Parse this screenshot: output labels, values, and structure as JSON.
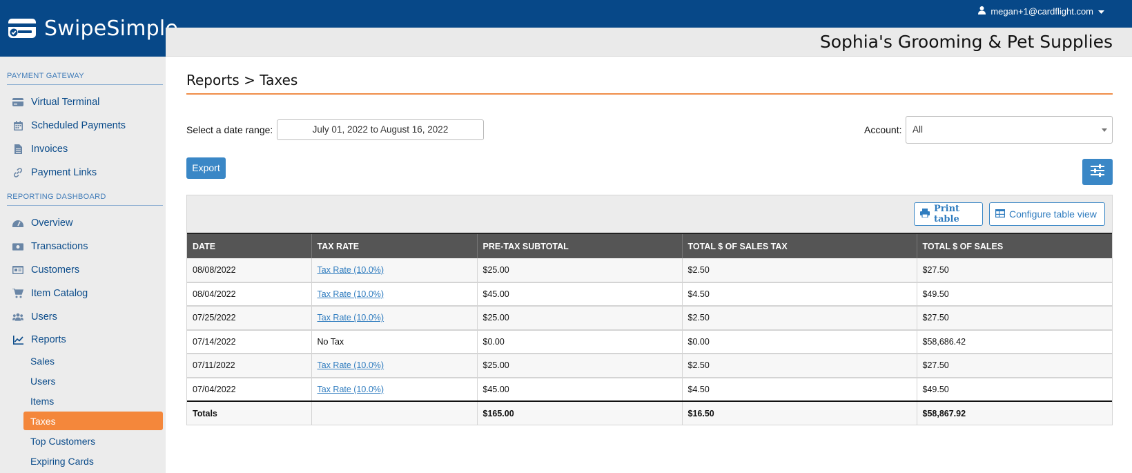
{
  "app": {
    "name": "SwipeSimple"
  },
  "user": {
    "email": "megan+1@cardflight.com"
  },
  "merchant": {
    "name": "Sophia's Grooming & Pet Supplies"
  },
  "sidebar": {
    "sections": [
      {
        "title": "PAYMENT GATEWAY"
      },
      {
        "title": "REPORTING DASHBOARD"
      }
    ],
    "gateway_items": [
      {
        "label": "Virtual Terminal",
        "icon": "credit-card-icon"
      },
      {
        "label": "Scheduled Payments",
        "icon": "calendar-icon"
      },
      {
        "label": "Invoices",
        "icon": "document-icon"
      },
      {
        "label": "Payment Links",
        "icon": "link-icon"
      }
    ],
    "dashboard_items": [
      {
        "label": "Overview",
        "icon": "gauge-icon"
      },
      {
        "label": "Transactions",
        "icon": "money-icon"
      },
      {
        "label": "Customers",
        "icon": "id-card-icon"
      },
      {
        "label": "Item Catalog",
        "icon": "cart-icon"
      },
      {
        "label": "Users",
        "icon": "users-icon"
      },
      {
        "label": "Reports",
        "icon": "chart-icon"
      }
    ],
    "report_subitems": [
      {
        "label": "Sales"
      },
      {
        "label": "Users"
      },
      {
        "label": "Items"
      },
      {
        "label": "Taxes",
        "active": true
      },
      {
        "label": "Top Customers"
      },
      {
        "label": "Expiring Cards"
      }
    ]
  },
  "page": {
    "breadcrumb": "Reports > Taxes",
    "date_range_label": "Select a date range:",
    "date_range_value": "July 01, 2022 to August 16, 2022",
    "account_label": "Account:",
    "account_value": "All",
    "export_label": "Export",
    "print_label": "Print table",
    "configure_label": "Configure table view"
  },
  "table": {
    "headers": [
      "DATE",
      "TAX RATE",
      "PRE-TAX SUBTOTAL",
      "TOTAL $ OF SALES TAX",
      "TOTAL $ OF SALES"
    ],
    "rows": [
      {
        "date": "08/08/2022",
        "rate": "Tax Rate (10.0%)",
        "rate_link": true,
        "subtotal": "$25.00",
        "tax": "$2.50",
        "total": "$27.50"
      },
      {
        "date": "08/04/2022",
        "rate": "Tax Rate (10.0%)",
        "rate_link": true,
        "subtotal": "$45.00",
        "tax": "$4.50",
        "total": "$49.50"
      },
      {
        "date": "07/25/2022",
        "rate": "Tax Rate (10.0%)",
        "rate_link": true,
        "subtotal": "$25.00",
        "tax": "$2.50",
        "total": "$27.50"
      },
      {
        "date": "07/14/2022",
        "rate": "No Tax",
        "rate_link": false,
        "subtotal": "$0.00",
        "tax": "$0.00",
        "total": "$58,686.42"
      },
      {
        "date": "07/11/2022",
        "rate": "Tax Rate (10.0%)",
        "rate_link": true,
        "subtotal": "$25.00",
        "tax": "$2.50",
        "total": "$27.50"
      },
      {
        "date": "07/04/2022",
        "rate": "Tax Rate (10.0%)",
        "rate_link": true,
        "subtotal": "$45.00",
        "tax": "$4.50",
        "total": "$49.50"
      }
    ],
    "totals": {
      "label": "Totals",
      "rate": "",
      "subtotal": "$165.00",
      "tax": "$16.50",
      "total": "$58,867.92"
    }
  },
  "colors": {
    "brand": "#074888",
    "accent": "#f4873b",
    "button": "#3a87c6",
    "header": "#555555"
  }
}
